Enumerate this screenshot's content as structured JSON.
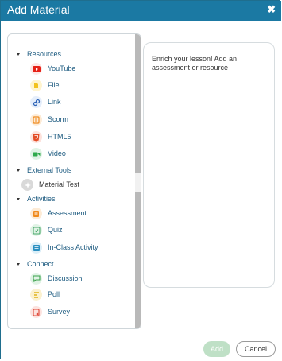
{
  "dialog": {
    "title": "Add Material",
    "close_symbol": "✖"
  },
  "colors": {
    "titlebar": "#1b79a3",
    "link_text": "#1d5b80",
    "add_button_bg": "#bfe0c6"
  },
  "sections": {
    "resources": {
      "label": "Resources",
      "items": [
        {
          "label": "YouTube",
          "icon": "youtube-icon",
          "color": "#e62117"
        },
        {
          "label": "File",
          "icon": "file-icon",
          "color": "#f2c21f"
        },
        {
          "label": "Link",
          "icon": "link-icon",
          "color": "#2e64b7"
        },
        {
          "label": "Scorm",
          "icon": "scorm-icon",
          "color": "#f08a1c"
        },
        {
          "label": "HTML5",
          "icon": "html5-icon",
          "color": "#e34c26"
        },
        {
          "label": "Video",
          "icon": "video-icon",
          "color": "#2faa4c"
        }
      ]
    },
    "external_tools": {
      "label": "External Tools",
      "items": [
        {
          "label": "Material Test",
          "icon": "tool-icon",
          "color": "#9a9a9a"
        }
      ]
    },
    "activities": {
      "label": "Activities",
      "items": [
        {
          "label": "Assessment",
          "icon": "assessment-icon",
          "color": "#f08a1c"
        },
        {
          "label": "Quiz",
          "icon": "quiz-icon",
          "color": "#4aa86c"
        },
        {
          "label": "In-Class Activity",
          "icon": "in-class-activity-icon",
          "color": "#2b8fc1"
        }
      ]
    },
    "connect": {
      "label": "Connect",
      "items": [
        {
          "label": "Discussion",
          "icon": "discussion-icon",
          "color": "#3aa04a"
        },
        {
          "label": "Poll",
          "icon": "poll-icon",
          "color": "#e0b21a"
        },
        {
          "label": "Survey",
          "icon": "survey-icon",
          "color": "#e04a3a"
        }
      ]
    }
  },
  "right_panel": {
    "text": "Enrich your lesson! Add an assessment or resource"
  },
  "buttons": {
    "add": "Add",
    "cancel": "Cancel"
  }
}
